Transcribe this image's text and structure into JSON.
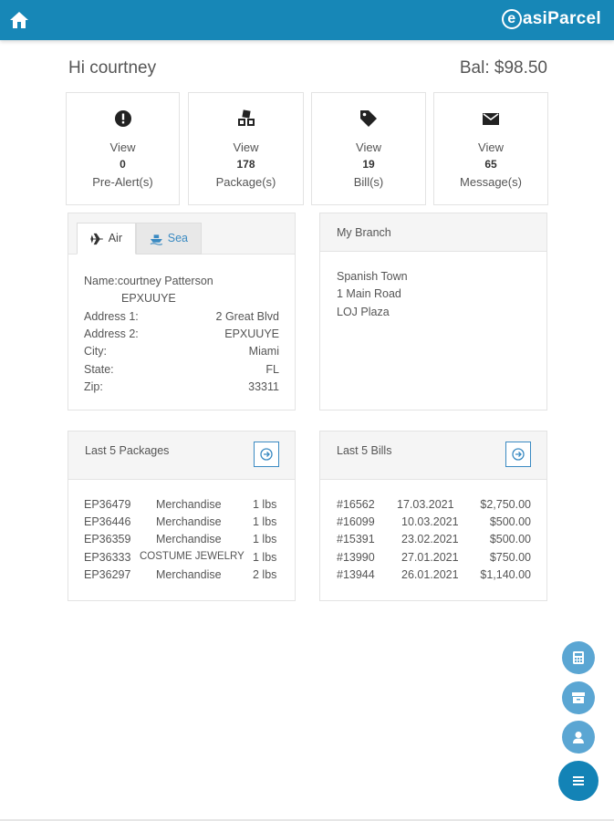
{
  "header": {
    "home_icon": "home-icon",
    "brand": {
      "e": "e",
      "rest": "asiParcel"
    },
    "bar_color": "#1787b7"
  },
  "greeting": "Hi courtney",
  "balance": "Bal: $98.50",
  "stats": [
    {
      "icon": "exclamation-circle-icon",
      "action": "View",
      "count": "0",
      "label": "Pre-Alert(s)"
    },
    {
      "icon": "cubes-icon",
      "action": "View",
      "count": "178",
      "label": "Package(s)"
    },
    {
      "icon": "tag-icon",
      "action": "View",
      "count": "19",
      "label": "Bill(s)"
    },
    {
      "icon": "envelope-icon",
      "action": "View",
      "count": "65",
      "label": "Message(s)"
    }
  ],
  "address_panel": {
    "tabs": [
      {
        "label": "Air",
        "icon": "plane-icon"
      },
      {
        "label": "Sea",
        "icon": "ship-icon"
      }
    ],
    "name_label": "Name:",
    "name": "courtney Patterson",
    "code": "EPXUUYE",
    "rows": [
      {
        "label": "Address 1:",
        "value": "2 Great Blvd"
      },
      {
        "label": "Address 2:",
        "value": "EPXUUYE"
      },
      {
        "label": "City:",
        "value": "Miami"
      },
      {
        "label": "State:",
        "value": "FL"
      },
      {
        "label": "Zip:",
        "value": "33311"
      }
    ]
  },
  "branch_panel": {
    "title": "My Branch",
    "lines": [
      "Spanish Town",
      "1 Main Road",
      "LOJ Plaza"
    ]
  },
  "packages_panel": {
    "title": "Last 5 Packages",
    "rows": [
      {
        "id": "EP36479",
        "desc": "Merchandise",
        "weight": "1 lbs"
      },
      {
        "id": "EP36446",
        "desc": "Merchandise",
        "weight": "1 lbs"
      },
      {
        "id": "EP36359",
        "desc": "Merchandise",
        "weight": "1 lbs"
      },
      {
        "id": "EP36333",
        "desc": "COSTUME JEWELRY",
        "weight": "1 lbs"
      },
      {
        "id": "EP36297",
        "desc": "Merchandise",
        "weight": "2 lbs"
      }
    ]
  },
  "bills_panel": {
    "title": "Last 5 Bills",
    "rows": [
      {
        "id": "#16562",
        "date": "17.03.2021",
        "amount": "$2,750.00"
      },
      {
        "id": "#16099",
        "date": "10.03.2021",
        "amount": "$500.00"
      },
      {
        "id": "#15391",
        "date": "23.02.2021",
        "amount": "$500.00"
      },
      {
        "id": "#13990",
        "date": "27.01.2021",
        "amount": "$750.00"
      },
      {
        "id": "#13944",
        "date": "26.01.2021",
        "amount": "$1,140.00"
      }
    ]
  },
  "fabs": [
    {
      "icon": "calculator-icon"
    },
    {
      "icon": "archive-icon"
    },
    {
      "icon": "user-icon"
    },
    {
      "icon": "menu-icon"
    }
  ]
}
